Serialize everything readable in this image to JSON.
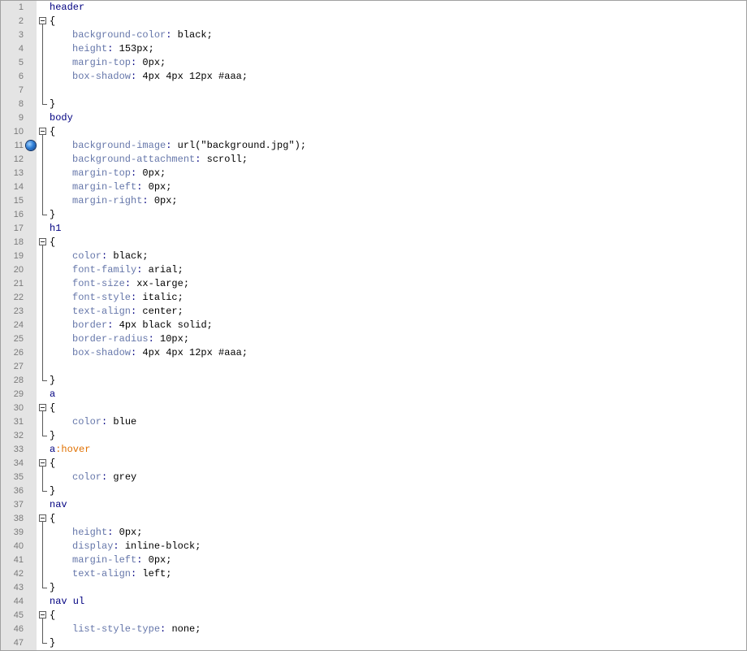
{
  "editor": {
    "lines": [
      {
        "n": "1",
        "kind": "selector",
        "text": "header"
      },
      {
        "n": "2",
        "kind": "open",
        "text": "{"
      },
      {
        "n": "3",
        "kind": "decl",
        "prop": "background-color",
        "val": "black;"
      },
      {
        "n": "4",
        "kind": "decl",
        "prop": "height",
        "val": "153px;"
      },
      {
        "n": "5",
        "kind": "decl",
        "prop": "margin-top",
        "val": "0px;"
      },
      {
        "n": "6",
        "kind": "decl",
        "prop": "box-shadow",
        "val": "4px 4px 12px #aaa;"
      },
      {
        "n": "7",
        "kind": "blank",
        "text": ""
      },
      {
        "n": "8",
        "kind": "close",
        "text": "}"
      },
      {
        "n": "9",
        "kind": "selector",
        "text": "body"
      },
      {
        "n": "10",
        "kind": "open",
        "text": "{"
      },
      {
        "n": "11",
        "kind": "decl",
        "prop": "background-image",
        "val": "url(\"background.jpg\");",
        "bookmark": true
      },
      {
        "n": "12",
        "kind": "decl",
        "prop": "background-attachment",
        "val": "scroll;"
      },
      {
        "n": "13",
        "kind": "decl",
        "prop": "margin-top",
        "val": "0px;"
      },
      {
        "n": "14",
        "kind": "decl",
        "prop": "margin-left",
        "val": "0px;"
      },
      {
        "n": "15",
        "kind": "decl",
        "prop": "margin-right",
        "val": "0px;"
      },
      {
        "n": "16",
        "kind": "close",
        "text": "}"
      },
      {
        "n": "17",
        "kind": "selector",
        "text": "h1"
      },
      {
        "n": "18",
        "kind": "open",
        "text": "{"
      },
      {
        "n": "19",
        "kind": "decl",
        "prop": "color",
        "val": "black;"
      },
      {
        "n": "20",
        "kind": "decl",
        "prop": "font-family",
        "val": "arial;"
      },
      {
        "n": "21",
        "kind": "decl",
        "prop": "font-size",
        "val": "xx-large;"
      },
      {
        "n": "22",
        "kind": "decl",
        "prop": "font-style",
        "val": "italic;"
      },
      {
        "n": "23",
        "kind": "decl",
        "prop": "text-align",
        "val": "center;"
      },
      {
        "n": "24",
        "kind": "decl",
        "prop": "border",
        "val": "4px black solid;"
      },
      {
        "n": "25",
        "kind": "decl",
        "prop": "border-radius",
        "val": "10px;"
      },
      {
        "n": "26",
        "kind": "decl",
        "prop": "box-shadow",
        "val": "4px 4px 12px #aaa;"
      },
      {
        "n": "27",
        "kind": "blank",
        "text": ""
      },
      {
        "n": "28",
        "kind": "close",
        "text": "}"
      },
      {
        "n": "29",
        "kind": "selector",
        "text": "a"
      },
      {
        "n": "30",
        "kind": "open",
        "text": "{"
      },
      {
        "n": "31",
        "kind": "decl",
        "prop": "color",
        "val": "blue"
      },
      {
        "n": "32",
        "kind": "close",
        "text": "}"
      },
      {
        "n": "33",
        "kind": "pseudo",
        "text": "a",
        "pseudo": ":hover"
      },
      {
        "n": "34",
        "kind": "open",
        "text": "{"
      },
      {
        "n": "35",
        "kind": "decl",
        "prop": "color",
        "val": "grey"
      },
      {
        "n": "36",
        "kind": "close",
        "text": "}"
      },
      {
        "n": "37",
        "kind": "selector",
        "text": "nav"
      },
      {
        "n": "38",
        "kind": "open",
        "text": "{"
      },
      {
        "n": "39",
        "kind": "decl",
        "prop": "height",
        "val": "0px;"
      },
      {
        "n": "40",
        "kind": "decl",
        "prop": "display",
        "val": "inline-block;"
      },
      {
        "n": "41",
        "kind": "decl",
        "prop": "margin-left",
        "val": "0px;"
      },
      {
        "n": "42",
        "kind": "decl",
        "prop": "text-align",
        "val": "left;"
      },
      {
        "n": "43",
        "kind": "close",
        "text": "}"
      },
      {
        "n": "44",
        "kind": "selector",
        "text": "nav ul"
      },
      {
        "n": "45",
        "kind": "open",
        "text": "{"
      },
      {
        "n": "46",
        "kind": "decl",
        "prop": "list-style-type",
        "val": "none;"
      },
      {
        "n": "47",
        "kind": "close",
        "text": "}"
      }
    ]
  },
  "colors": {
    "selector": "#000080",
    "property": "#6677aa",
    "pseudo": "#e07000",
    "gutter": "#e4e4e4"
  },
  "icons": {
    "bookmark": "bookmark-icon",
    "fold": "fold-collapse-icon"
  }
}
